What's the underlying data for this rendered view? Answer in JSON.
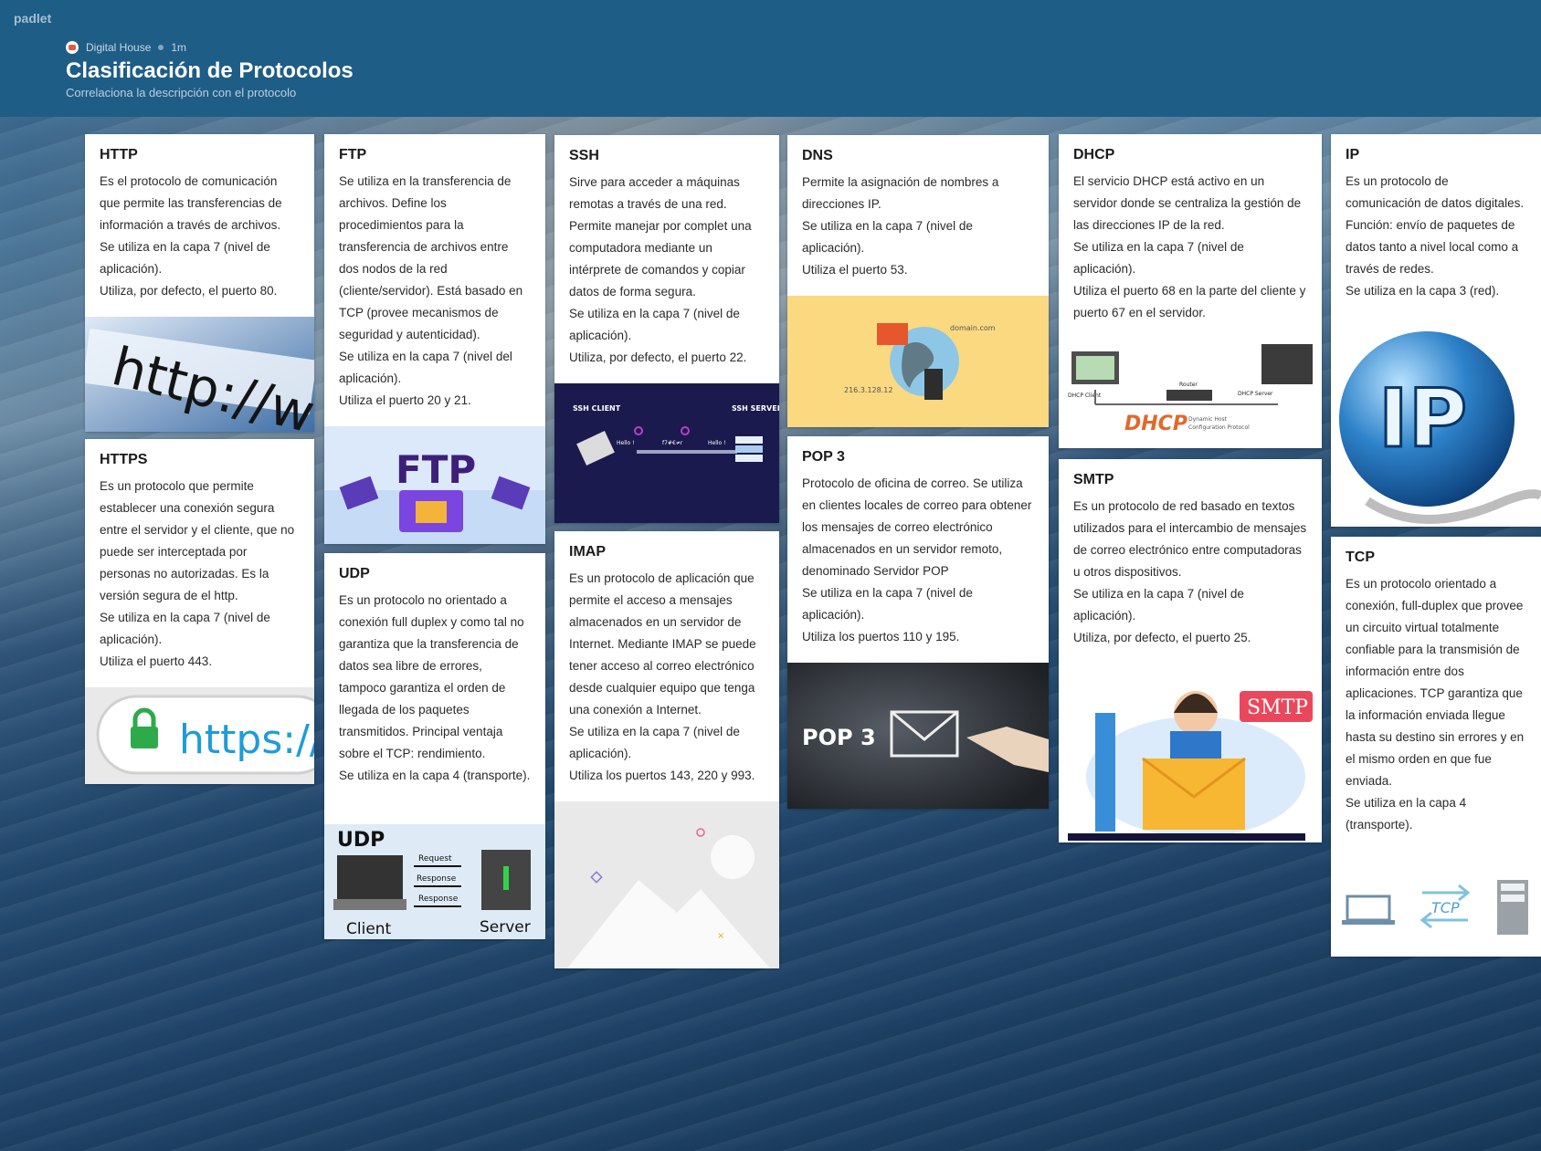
{
  "app": {
    "brand": "padlet"
  },
  "header": {
    "author": "Digital House",
    "age": "1m",
    "title": "Clasificación de Protocolos",
    "subtitle": "Correlaciona la descripción con el protocolo"
  },
  "cards": {
    "http": {
      "title": "HTTP",
      "lines": [
        "Es el protocolo de comunicación que permite las transferencias de información a través de archivos.",
        "Se utiliza en la capa 7 (nivel de aplicación).",
        "Utiliza, por defecto, el puerto 80."
      ],
      "image_text": "http://www"
    },
    "https": {
      "title": "HTTPS",
      "lines": [
        "Es un protocolo que permite establecer una conexión segura entre el servidor y el cliente, que no puede ser interceptada por personas no autorizadas. Es la versión segura de el http.",
        "Se utiliza en la capa 7 (nivel de aplicación).",
        "Utiliza el puerto 443."
      ],
      "image_text": "https://"
    },
    "ftp": {
      "title": "FTP",
      "lines": [
        "Se utiliza en la transferencia de archivos. Define los procedimientos para la transferencia de archivos entre dos nodos de la red (cliente/servidor). Está basado en TCP (provee mecanismos de seguridad y autenticidad).",
        "Se utiliza en la capa 7 (nivel del aplicación).",
        "Utiliza el puerto 20 y 21."
      ],
      "image_text": "FTP"
    },
    "udp": {
      "title": "UDP",
      "lines": [
        "Es un protocolo no orientado a conexión full duplex y como tal no garantiza que la transferencia de datos sea libre de errores, tampoco garantiza el orden de llegada de los paquetes transmitidos. Principal ventaja sobre el TCP: rendimiento.",
        "Se utiliza en la capa 4 (transporte)."
      ],
      "image_labels": {
        "title": "UDP",
        "request": "Request",
        "response1": "Response",
        "response2": "Response",
        "client": "Client",
        "server": "Server"
      }
    },
    "ssh": {
      "title": "SSH",
      "lines": [
        "Sirve para acceder a máquinas remotas a través de una red. Permite manejar por complet una computadora mediante un intérprete de comandos y copiar datos de forma segura.",
        "Se utiliza en la capa 7 (nivel de aplicación).",
        "Utiliza, por defecto, el puerto 22."
      ],
      "image_labels": {
        "client": "SSH CLIENT",
        "server": "SSH SERVER",
        "hello1": "Hello !",
        "cipher": "f7#€≠r",
        "hello2": "Hello !"
      }
    },
    "imap": {
      "title": "IMAP",
      "lines": [
        "Es un protocolo de aplicación que permite el acceso a mensajes almacenados en un servidor de Internet. Mediante IMAP se puede tener acceso al correo electrónico desde cualquier equipo que tenga una conexión a Internet.",
        "Se utiliza en la capa 7 (nivel de aplicación).",
        "Utiliza los puertos 143, 220 y 993."
      ]
    },
    "dns": {
      "title": "DNS",
      "lines": [
        "Permite la asignación de nombres a direcciones IP.",
        "Se utiliza en la capa 7 (nivel de aplicación).",
        "Utiliza el puerto 53."
      ],
      "image_labels": {
        "domain": "domain.com",
        "ip": "216.3.128.12"
      }
    },
    "pop3": {
      "title": "POP 3",
      "lines": [
        "Protocolo de oficina de correo. Se utiliza en clientes locales de correo para obtener los mensajes de correo electrónico almacenados en un servidor remoto, denominado Servidor POP",
        "Se utiliza en la capa 7 (nivel de aplicación).",
        "Utiliza los puertos 110 y 195."
      ],
      "image_text": "POP 3"
    },
    "dhcp": {
      "title": "DHCP",
      "lines": [
        "El servicio DHCP está activo en un servidor donde se centraliza la gestión de las direcciones IP de la red.",
        "Se utiliza en la capa 7 (nivel de aplicación).",
        "Utiliza el puerto 68 en la parte del cliente y puerto 67 en el servidor."
      ],
      "image_labels": {
        "client": "DHCP Client",
        "router": "Router",
        "server": "DHCP Server",
        "logo": "DHCP",
        "caption1": "Dynamic Host",
        "caption2": "Configuration Protocol"
      }
    },
    "smtp": {
      "title": "SMTP",
      "lines": [
        "Es un protocolo de red basado en textos utilizados para el intercambio de mensajes de correo electrónico entre computadoras u otros dispositivos.",
        "Se utiliza en la capa 7 (nivel de aplicación).",
        "Utiliza, por defecto, el puerto 25."
      ],
      "image_text": "SMTP"
    },
    "ip": {
      "title": "IP",
      "lines": [
        "Es un protocolo de comunicación de datos digitales. Función: envío de paquetes de datos tanto a nivel local como a través de redes.",
        "Se utiliza en la capa 3 (red)."
      ],
      "image_text": "IP"
    },
    "tcp": {
      "title": "TCP",
      "lines": [
        "Es un protocolo orientado a conexión, full-duplex que provee un circuito virtual totalmente confiable para la transmisión de información entre dos aplicaciones. TCP garantiza que la información enviada llegue hasta su destino sin errores y en el mismo orden en que fue enviada.",
        "Se utiliza en la capa 4 (transporte)."
      ],
      "image_text": "TCP"
    }
  }
}
